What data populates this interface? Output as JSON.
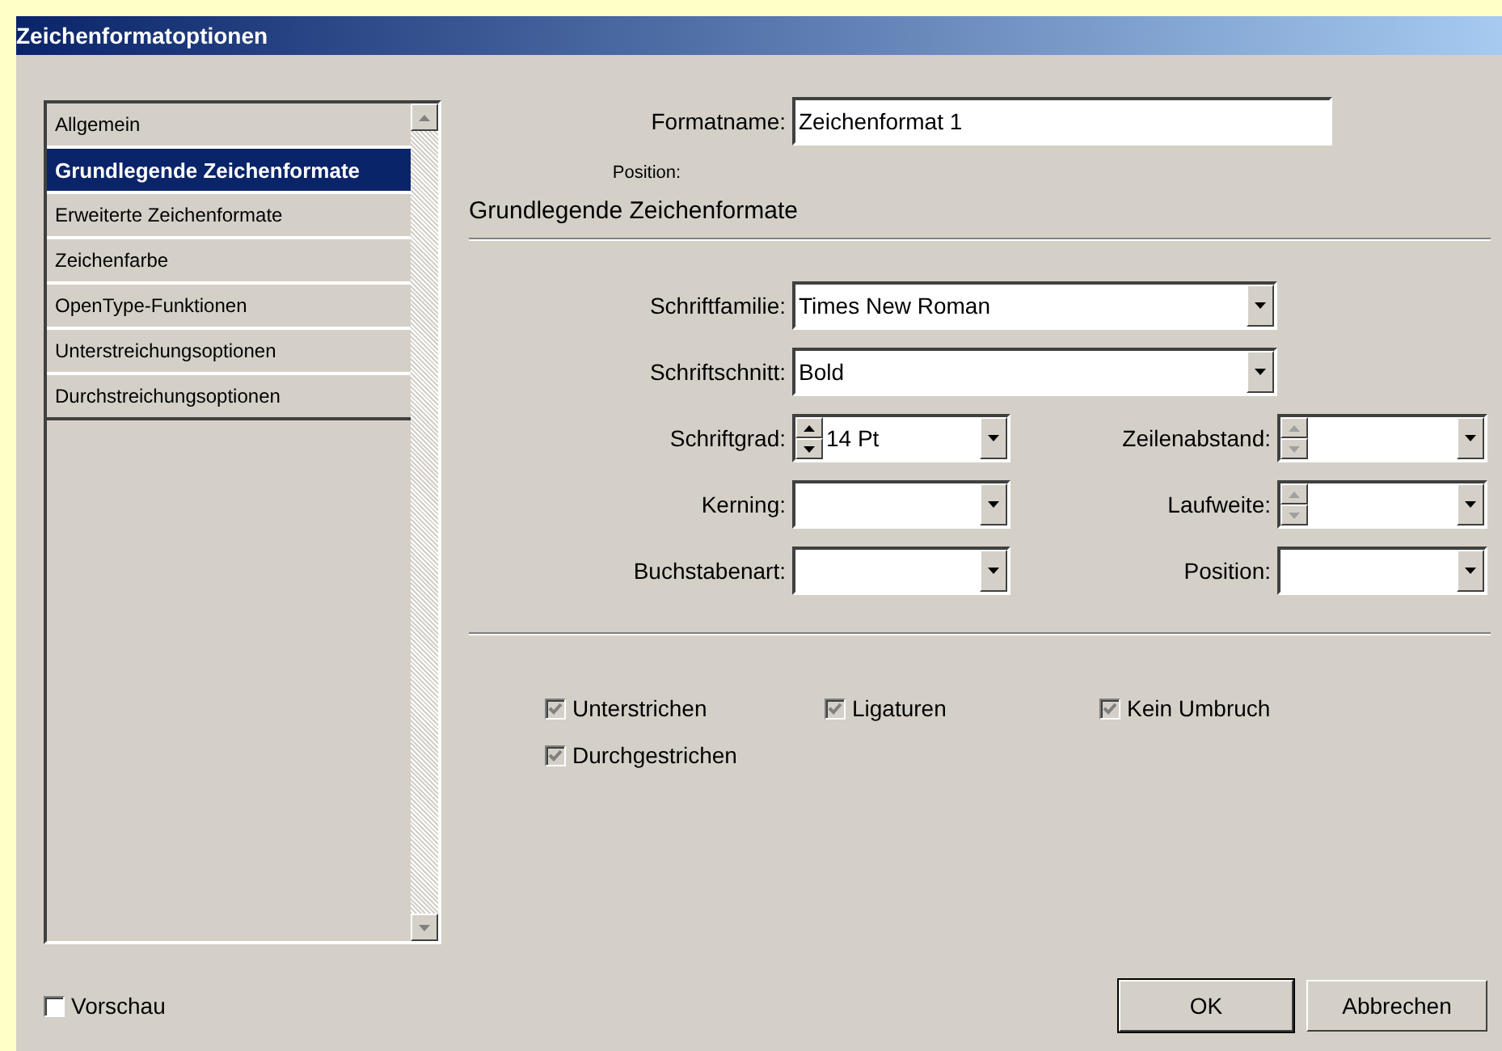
{
  "window": {
    "title": "Zeichenformatoptionen"
  },
  "sidebar": {
    "items": [
      {
        "label": "Allgemein",
        "selected": false
      },
      {
        "label": "Grundlegende Zeichenformate",
        "selected": true
      },
      {
        "label": "Erweiterte Zeichenformate",
        "selected": false
      },
      {
        "label": "Zeichenfarbe",
        "selected": false
      },
      {
        "label": "OpenType-Funktionen",
        "selected": false
      },
      {
        "label": "Unterstreichungsoptionen",
        "selected": false
      },
      {
        "label": "Durchstreichungsoptionen",
        "selected": false
      }
    ]
  },
  "format_name": {
    "label": "Formatname:",
    "value": "Zeichenformat 1"
  },
  "position_label": "Position:",
  "section_title": "Grundlegende Zeichenformate",
  "fields": [
    {
      "label": "Schriftfamilie:",
      "value": "Times New Roman",
      "kind": "wide"
    },
    {
      "label": "Schriftschnitt:",
      "value": "Bold",
      "kind": "wide"
    },
    {
      "label": "Schriftgrad:",
      "value": "14 Pt",
      "kind": "spin",
      "disabled": false
    },
    {
      "label": "Zeilenabstand:",
      "kind": "spin",
      "disabled": true
    },
    {
      "label": "Kerning:",
      "kind": "combo"
    },
    {
      "label": "Laufweite:",
      "kind": "spin",
      "disabled": true
    },
    {
      "label": "Buchstabenart:",
      "kind": "combo"
    },
    {
      "label": "Position:",
      "kind": "combo"
    }
  ],
  "checkboxes": [
    {
      "label": "Unterstrichen",
      "checked": true,
      "disabled": true
    },
    {
      "label": "Ligaturen",
      "checked": true,
      "disabled": true
    },
    {
      "label": "Kein Umbruch",
      "checked": true,
      "disabled": true
    },
    {
      "label": "Durchgestrichen",
      "checked": true,
      "disabled": true
    }
  ],
  "preview": {
    "label": "Vorschau",
    "checked": false
  },
  "buttons": [
    {
      "label": "OK",
      "default": true
    },
    {
      "label": "Abbrechen",
      "default": false
    }
  ]
}
